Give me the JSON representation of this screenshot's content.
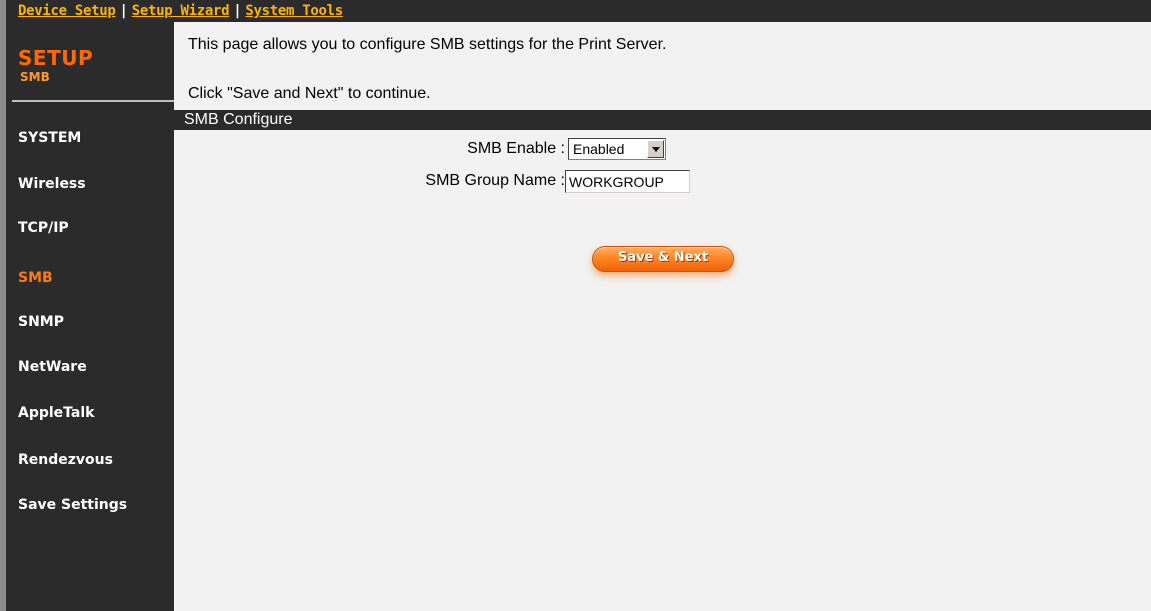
{
  "topnav": {
    "device_setup": "Device Setup",
    "separator": "|",
    "setup_wizard": "Setup Wizard",
    "system_tools": "System Tools"
  },
  "sidebar": {
    "title": "SETUP",
    "subtitle": "SMB",
    "items": [
      {
        "label": "SYSTEM",
        "active": false
      },
      {
        "label": "Wireless",
        "active": false
      },
      {
        "label": "TCP/IP",
        "active": false
      },
      {
        "label": "SMB",
        "active": true
      },
      {
        "label": "SNMP",
        "active": false
      },
      {
        "label": "NetWare",
        "active": false
      },
      {
        "label": "AppleTalk",
        "active": false
      },
      {
        "label": "Rendezvous",
        "active": false
      },
      {
        "label": "Save Settings",
        "active": false
      }
    ]
  },
  "main": {
    "intro": "This page allows you to configure SMB settings for the Print Server.",
    "instruction": "Click \"Save and Next\" to continue.",
    "section_title": "SMB Configure",
    "smb_enable_label": "SMB Enable :",
    "smb_enable_value": "Enabled",
    "group_name_label": "SMB Group Name :",
    "group_name_value": "WORKGROUP",
    "save_button": "Save & Next"
  },
  "colors": {
    "dark_bar": "#2b2b2b",
    "accent_orange": "#ff7a10",
    "link_yellow": "#ffb400",
    "content_bg": "#f2f2f2"
  }
}
